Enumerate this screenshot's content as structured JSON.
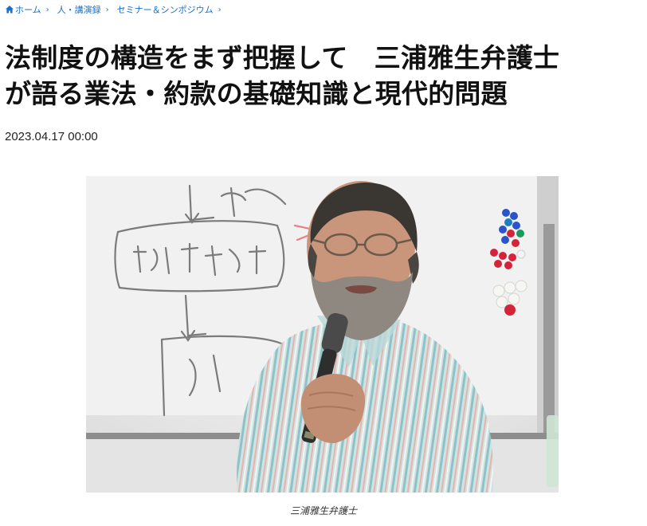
{
  "breadcrumb": {
    "items": [
      {
        "label": "ホーム",
        "icon": "home-icon"
      },
      {
        "label": "人・講演録"
      },
      {
        "label": "セミナー＆シンポジウム"
      }
    ],
    "separator": "›",
    "color": "#1b6fc9"
  },
  "article": {
    "title_line1": "法制度の構造をまず把握して　三浦雅生弁護士",
    "title_line2": "が語る業法・約款の基礎知識と現代的問題",
    "date": "2023.04.17  00:00"
  },
  "figure": {
    "image_alt": "三浦雅生弁護士",
    "caption": "三浦雅生弁護士"
  }
}
